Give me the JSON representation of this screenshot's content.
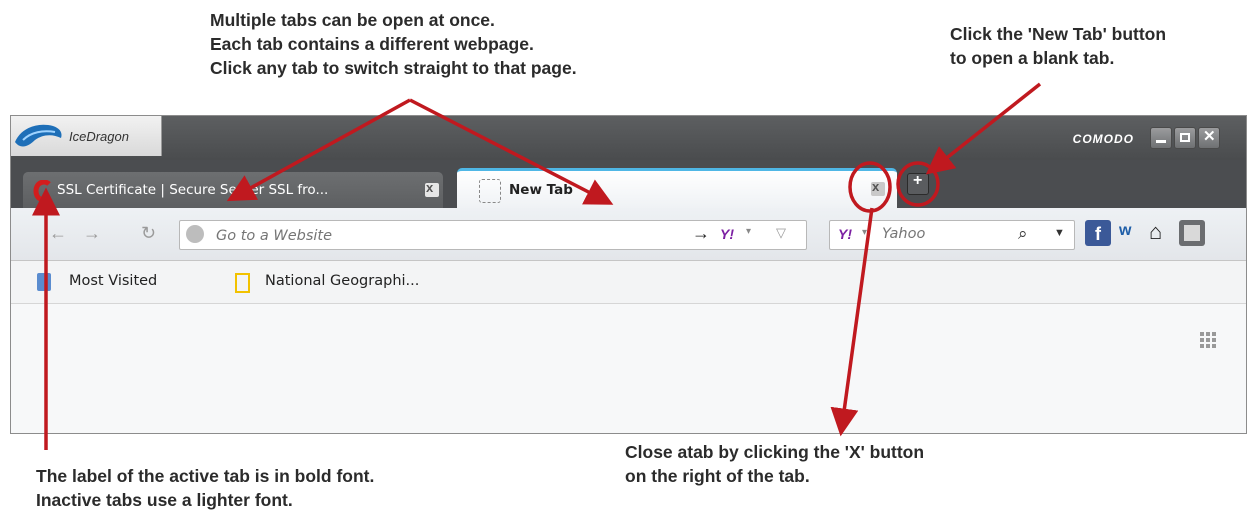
{
  "callouts": {
    "tabs": [
      "Multiple tabs can be open at once.",
      "Each tab contains a different webpage.",
      "Click any tab to switch straight to that page."
    ],
    "newtab": [
      "Click the 'New Tab' button",
      "to open a blank tab."
    ],
    "active": [
      "The label of the active tab is in bold font.",
      "Inactive tabs use a lighter font."
    ],
    "close": [
      "Close atab by clicking the 'X' button",
      "on the right of the tab."
    ]
  },
  "browser": {
    "brand": "IceDragon",
    "vendor": "COMODO",
    "tabs": [
      {
        "label": "SSL Certificate | Secure Server SSL fro...",
        "active": false,
        "icon": "comodo-c-icon"
      },
      {
        "label": "New Tab",
        "active": true,
        "icon": "blank-page-icon"
      }
    ],
    "new_tab_button": "+",
    "address_bar": {
      "placeholder": "Go to a Website"
    },
    "search": {
      "placeholder": "Yahoo",
      "engine": "Y!"
    },
    "bookmarks": [
      {
        "label": "Most Visited",
        "icon": "bookmark-folder-icon"
      },
      {
        "label": "National Geographi...",
        "icon": "natgeo-icon"
      }
    ]
  },
  "colors": {
    "arrow": "#c0191f",
    "active_tab_accent": "#4fb7e6"
  }
}
